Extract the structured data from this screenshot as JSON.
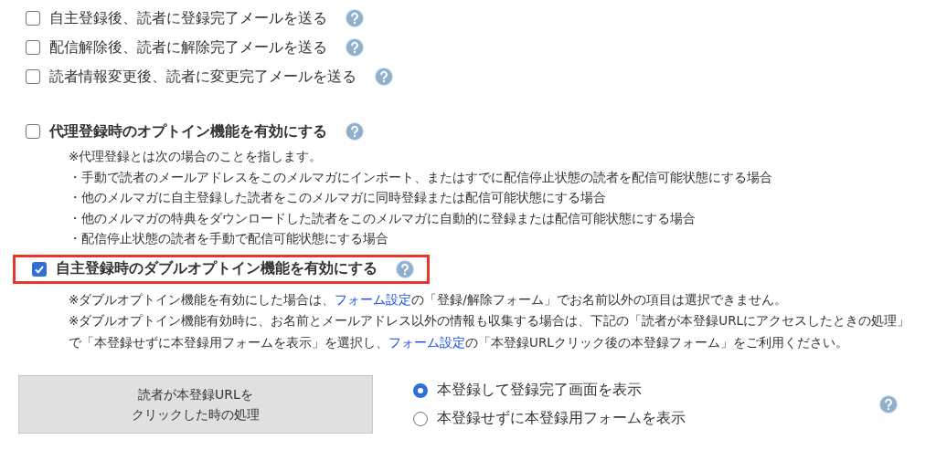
{
  "mail_options": [
    {
      "label": "自主登録後、読者に登録完了メールを送る",
      "checked": false
    },
    {
      "label": "配信解除後、読者に解除完了メールを送る",
      "checked": false
    },
    {
      "label": "読者情報変更後、読者に変更完了メールを送る",
      "checked": false
    }
  ],
  "proxy_optin": {
    "label": "代理登録時のオプトイン機能を有効にする",
    "checked": false,
    "notes": [
      "※代理登録とは次の場合のことを指します。",
      "・手動で読者のメールアドレスをこのメルマガにインポート、またはすでに配信停止状態の読者を配信可能状態にする場合",
      "・他のメルマガに自主登録した読者をこのメルマガに同時登録または配信可能状態にする場合",
      "・他のメルマガの特典をダウンロードした読者をこのメルマガに自動的に登録または配信可能状態にする場合",
      "・配信停止状態の読者を手動で配信可能状態にする場合"
    ]
  },
  "double_optin": {
    "label": "自主登録時のダブルオプトイン機能を有効にする",
    "checked": true,
    "highlighted": true,
    "notes": [
      [
        {
          "kind": "text",
          "text": "※ダブルオプトイン機能を有効にした場合は、"
        },
        {
          "kind": "link",
          "text": "フォーム設定"
        },
        {
          "kind": "text",
          "text": "の「登録/解除フォーム」でお名前以外の項目は選択できません。"
        }
      ],
      [
        {
          "kind": "text",
          "text": "※ダブルオプトイン機能有効時に、お名前とメールアドレス以外の情報も収集する場合は、下記の「読者が本登録URLにアクセスしたときの処理」で「本登録せずに本登録用フォームを表示」を選択し、"
        },
        {
          "kind": "link",
          "text": "フォーム設定"
        },
        {
          "kind": "text",
          "text": "の「本登録URLクリック後の本登録フォーム」をご利用ください。"
        }
      ]
    ]
  },
  "url_click": {
    "heading_lines": [
      "読者が本登録URLを",
      "クリックした時の処理"
    ],
    "options": [
      {
        "label": "本登録して登録完了画面を表示",
        "selected": true
      },
      {
        "label": "本登録せずに本登録用フォームを表示",
        "selected": false
      }
    ]
  }
}
